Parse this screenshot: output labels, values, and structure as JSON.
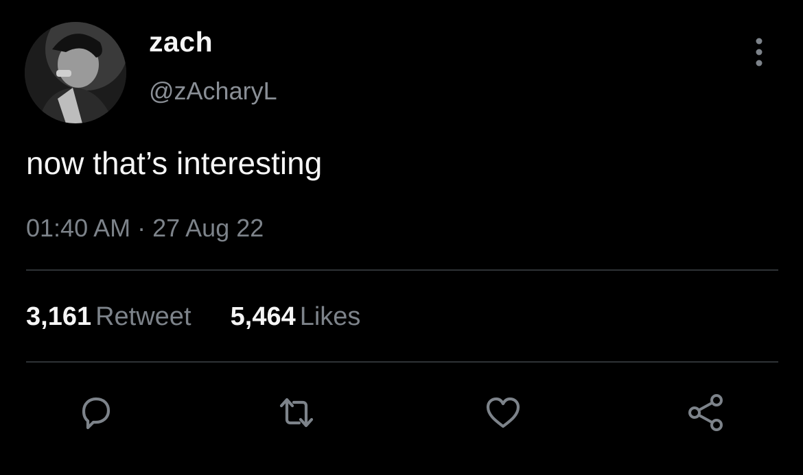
{
  "user": {
    "display_name": "zach",
    "handle": "@zAcharyL"
  },
  "tweet": {
    "text": "now that’s interesting",
    "timestamp": "01:40 AM · 27 Aug 22"
  },
  "stats": {
    "retweets_count": "3,161",
    "retweets_label": "Retweet",
    "likes_count": "5,464",
    "likes_label": "Likes"
  },
  "actions": {
    "reply_icon": "reply-icon",
    "retweet_icon": "retweet-icon",
    "like_icon": "heart-icon",
    "share_icon": "share-icon"
  },
  "colors": {
    "background": "#000000",
    "text_primary": "#f5f5f5",
    "text_secondary": "#7d838a",
    "divider": "#2f3336",
    "icon": "#7d838a"
  }
}
